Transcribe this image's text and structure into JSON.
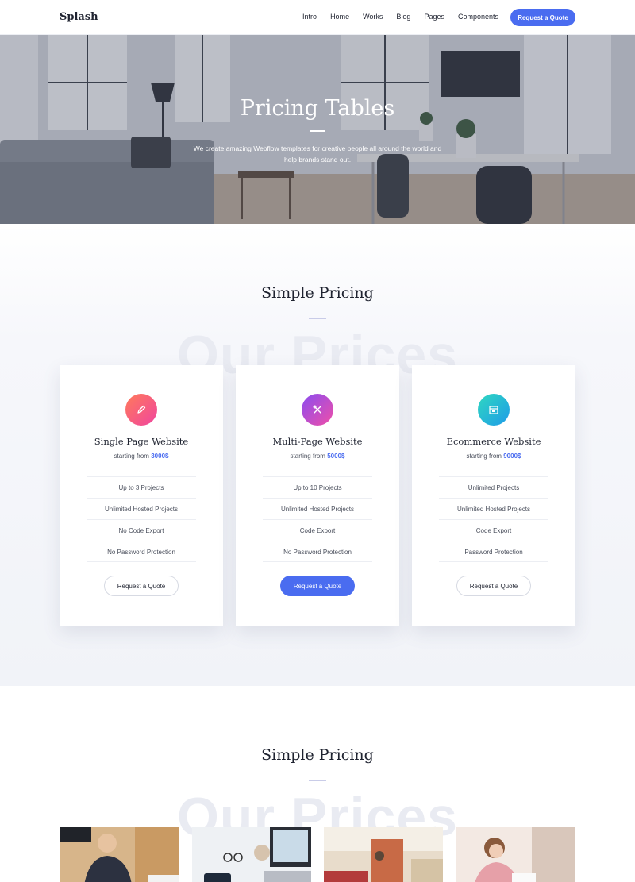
{
  "nav": {
    "brand": "Splash",
    "items": [
      "Intro",
      "Home",
      "Works",
      "Blog",
      "Pages",
      "Components"
    ],
    "cta": "Request a Quote"
  },
  "hero": {
    "title": "Pricing Tables",
    "subtitle": "We create amazing Webflow templates for creative people all around the world and help brands stand out."
  },
  "pricing": {
    "title": "Simple Pricing",
    "ghost": "Our Prices",
    "plans": [
      {
        "name": "Single Page Website",
        "price_prefix": "starting from",
        "price": "3000$",
        "icon": "pen-icon",
        "features": [
          "Up to 3 Projects",
          "Unlimited Hosted Projects",
          "No Code Export",
          "No Password Protection"
        ],
        "button": "Request a Quote",
        "highlighted": false
      },
      {
        "name": "Multi-Page Website",
        "price_prefix": "starting from",
        "price": "5000$",
        "icon": "tools-icon",
        "features": [
          "Up to 10 Projects",
          "Unlimited Hosted Projects",
          "Code Export",
          "No Password Protection"
        ],
        "button": "Request a Quote",
        "highlighted": true
      },
      {
        "name": "Ecommerce Website",
        "price_prefix": "starting from",
        "price": "9000$",
        "icon": "store-icon",
        "features": [
          "Unlimited Projects",
          "Unlimited Hosted Projects",
          "Code Export",
          "Password Protection"
        ],
        "button": "Request a Quote",
        "highlighted": false
      }
    ]
  },
  "pricing2": {
    "title": "Simple Pricing",
    "ghost": "Our Prices"
  },
  "colors": {
    "accent": "#4a6cf0",
    "icon1": [
      "#ff6a6a",
      "#f04fa8"
    ],
    "icon2": [
      "#a14cf0",
      "#f04fa8"
    ],
    "icon3": [
      "#2fd3c4",
      "#1fa6e8"
    ]
  }
}
